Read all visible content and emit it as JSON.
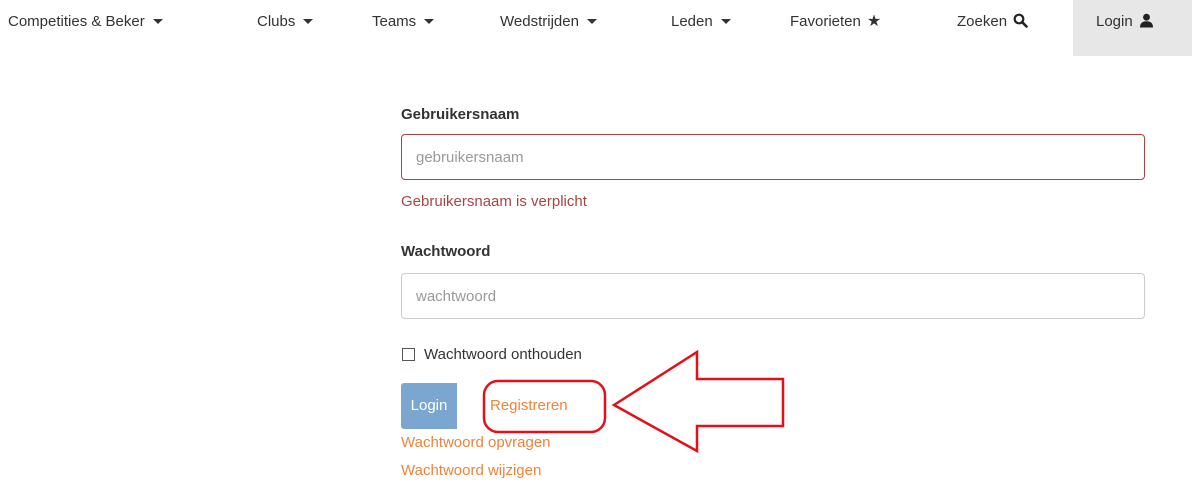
{
  "nav": {
    "items": [
      {
        "label": "Competities & Beker"
      },
      {
        "label": "Clubs"
      },
      {
        "label": "Teams"
      },
      {
        "label": "Wedstrijden"
      },
      {
        "label": "Leden"
      },
      {
        "label": "Favorieten"
      },
      {
        "label": "Zoeken"
      },
      {
        "label": "Login"
      }
    ],
    "icons": {
      "favorites": "star-icon",
      "search": "search-icon",
      "login": "user-icon"
    }
  },
  "form": {
    "username": {
      "label": "Gebruikersnaam",
      "placeholder": "gebruikersnaam",
      "value": "",
      "error": "Gebruikersnaam is verplicht"
    },
    "password": {
      "label": "Wachtwoord",
      "placeholder": "wachtwoord",
      "value": ""
    },
    "remember": {
      "label": "Wachtwoord onthouden",
      "checked": false
    },
    "login_button": "Login",
    "register_link": "Registreren",
    "request_password_link": "Wachtwoord opvragen",
    "change_password_link": "Wachtwoord wijzigen"
  },
  "colors": {
    "error": "#a94442",
    "link": "#f0823a",
    "button": "#7ba6cf",
    "annotation": "#e3101a",
    "nav_active_bg": "#e7e7e7"
  }
}
